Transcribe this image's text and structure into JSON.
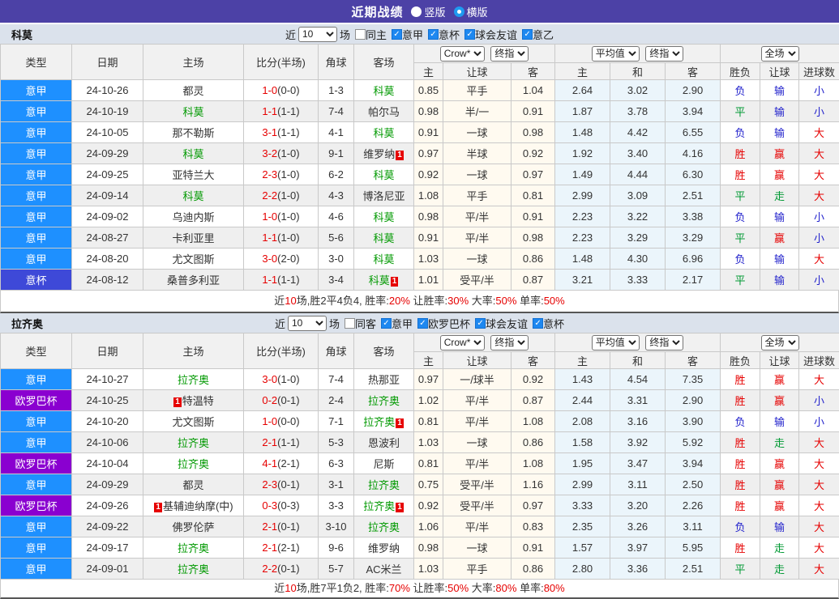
{
  "title_bar": {
    "title": "近期战绩",
    "options": [
      {
        "label": "竖版",
        "checked": false
      },
      {
        "label": "横版",
        "checked": true
      }
    ]
  },
  "red_card_label": "1",
  "league_colors": {
    "意甲": "#1e90ff",
    "意杯": "#3e49d8",
    "欧罗巴杯": "#8a00d0"
  },
  "result_colors": {
    "胜": "#e60000",
    "赢": "#e60000",
    "大": "#e60000",
    "平": "#009933",
    "走": "#009933",
    "负": "#2222cc",
    "输": "#2222cc",
    "小": "#2222cc"
  },
  "header_labels": {
    "left": [
      "类型",
      "日期",
      "主场",
      "比分(半场)",
      "角球",
      "客场"
    ],
    "odds_select1": "Crow*",
    "odds_select2": "终指",
    "odds_cols": [
      "主",
      "让球",
      "客"
    ],
    "avg_select1": "平均值",
    "avg_select2": "终指",
    "avg_cols": [
      "主",
      "和",
      "客"
    ],
    "full_select": "全场",
    "full_cols": [
      "胜负",
      "让球",
      "进球数"
    ]
  },
  "sections": [
    {
      "team": "科莫",
      "filter": {
        "near": "近",
        "count": "10",
        "games": "场",
        "same": {
          "label": "同主",
          "checked": false
        },
        "leagues": [
          {
            "label": "意甲",
            "checked": true
          },
          {
            "label": "意杯",
            "checked": true
          },
          {
            "label": "球会友谊",
            "checked": true
          },
          {
            "label": "意乙",
            "checked": true
          }
        ]
      },
      "rows": [
        {
          "league": "意甲",
          "date": "24-10-26",
          "home": {
            "name": "都灵",
            "focus": false,
            "rc": ""
          },
          "score": "1-0",
          "half": "(0-0)",
          "corner": "1-3",
          "away": {
            "name": "科莫",
            "focus": true,
            "rc": ""
          },
          "odds": [
            "0.85",
            "平手",
            "1.04"
          ],
          "avg": [
            "2.64",
            "3.02",
            "2.90"
          ],
          "result": [
            "负",
            "输",
            "小"
          ]
        },
        {
          "league": "意甲",
          "date": "24-10-19",
          "home": {
            "name": "科莫",
            "focus": true,
            "rc": ""
          },
          "score": "1-1",
          "half": "(1-1)",
          "corner": "7-4",
          "away": {
            "name": "帕尔马",
            "focus": false,
            "rc": ""
          },
          "odds": [
            "0.98",
            "半/一",
            "0.91"
          ],
          "avg": [
            "1.87",
            "3.78",
            "3.94"
          ],
          "result": [
            "平",
            "输",
            "小"
          ]
        },
        {
          "league": "意甲",
          "date": "24-10-05",
          "home": {
            "name": "那不勒斯",
            "focus": false,
            "rc": ""
          },
          "score": "3-1",
          "half": "(1-1)",
          "corner": "4-1",
          "away": {
            "name": "科莫",
            "focus": true,
            "rc": ""
          },
          "odds": [
            "0.91",
            "一球",
            "0.98"
          ],
          "avg": [
            "1.48",
            "4.42",
            "6.55"
          ],
          "result": [
            "负",
            "输",
            "大"
          ]
        },
        {
          "league": "意甲",
          "date": "24-09-29",
          "home": {
            "name": "科莫",
            "focus": true,
            "rc": ""
          },
          "score": "3-2",
          "half": "(1-0)",
          "corner": "9-1",
          "away": {
            "name": "维罗纳",
            "focus": false,
            "rc": "after"
          },
          "odds": [
            "0.97",
            "半球",
            "0.92"
          ],
          "avg": [
            "1.92",
            "3.40",
            "4.16"
          ],
          "result": [
            "胜",
            "赢",
            "大"
          ]
        },
        {
          "league": "意甲",
          "date": "24-09-25",
          "home": {
            "name": "亚特兰大",
            "focus": false,
            "rc": ""
          },
          "score": "2-3",
          "half": "(1-0)",
          "corner": "6-2",
          "away": {
            "name": "科莫",
            "focus": true,
            "rc": ""
          },
          "odds": [
            "0.92",
            "一球",
            "0.97"
          ],
          "avg": [
            "1.49",
            "4.44",
            "6.30"
          ],
          "result": [
            "胜",
            "赢",
            "大"
          ]
        },
        {
          "league": "意甲",
          "date": "24-09-14",
          "home": {
            "name": "科莫",
            "focus": true,
            "rc": ""
          },
          "score": "2-2",
          "half": "(1-0)",
          "corner": "4-3",
          "away": {
            "name": "博洛尼亚",
            "focus": false,
            "rc": ""
          },
          "odds": [
            "1.08",
            "平手",
            "0.81"
          ],
          "avg": [
            "2.99",
            "3.09",
            "2.51"
          ],
          "result": [
            "平",
            "走",
            "大"
          ]
        },
        {
          "league": "意甲",
          "date": "24-09-02",
          "home": {
            "name": "乌迪内斯",
            "focus": false,
            "rc": ""
          },
          "score": "1-0",
          "half": "(1-0)",
          "corner": "4-6",
          "away": {
            "name": "科莫",
            "focus": true,
            "rc": ""
          },
          "odds": [
            "0.98",
            "平/半",
            "0.91"
          ],
          "avg": [
            "2.23",
            "3.22",
            "3.38"
          ],
          "result": [
            "负",
            "输",
            "小"
          ]
        },
        {
          "league": "意甲",
          "date": "24-08-27",
          "home": {
            "name": "卡利亚里",
            "focus": false,
            "rc": ""
          },
          "score": "1-1",
          "half": "(1-0)",
          "corner": "5-6",
          "away": {
            "name": "科莫",
            "focus": true,
            "rc": ""
          },
          "odds": [
            "0.91",
            "平/半",
            "0.98"
          ],
          "avg": [
            "2.23",
            "3.29",
            "3.29"
          ],
          "result": [
            "平",
            "赢",
            "小"
          ]
        },
        {
          "league": "意甲",
          "date": "24-08-20",
          "home": {
            "name": "尤文图斯",
            "focus": false,
            "rc": ""
          },
          "score": "3-0",
          "half": "(2-0)",
          "corner": "3-0",
          "away": {
            "name": "科莫",
            "focus": true,
            "rc": ""
          },
          "odds": [
            "1.03",
            "一球",
            "0.86"
          ],
          "avg": [
            "1.48",
            "4.30",
            "6.96"
          ],
          "result": [
            "负",
            "输",
            "大"
          ]
        },
        {
          "league": "意杯",
          "date": "24-08-12",
          "home": {
            "name": "桑普多利亚",
            "focus": false,
            "rc": ""
          },
          "score": "1-1",
          "half": "(1-1)",
          "corner": "3-4",
          "away": {
            "name": "科莫",
            "focus": true,
            "rc": "after"
          },
          "odds": [
            "1.01",
            "受平/半",
            "0.87"
          ],
          "avg": [
            "3.21",
            "3.33",
            "2.17"
          ],
          "result": [
            "平",
            "输",
            "小"
          ]
        }
      ],
      "summary": [
        {
          "t": "近",
          "r": false
        },
        {
          "t": "10",
          "r": true
        },
        {
          "t": "场,胜2平4负4, 胜率:",
          "r": false
        },
        {
          "t": "20%",
          "r": true
        },
        {
          "t": " 让胜率:",
          "r": false
        },
        {
          "t": "30%",
          "r": true
        },
        {
          "t": " 大率:",
          "r": false
        },
        {
          "t": "50%",
          "r": true
        },
        {
          "t": " 单率:",
          "r": false
        },
        {
          "t": "50%",
          "r": true
        }
      ]
    },
    {
      "team": "拉齐奥",
      "filter": {
        "near": "近",
        "count": "10",
        "games": "场",
        "same": {
          "label": "同客",
          "checked": false
        },
        "leagues": [
          {
            "label": "意甲",
            "checked": true
          },
          {
            "label": "欧罗巴杯",
            "checked": true
          },
          {
            "label": "球会友谊",
            "checked": true
          },
          {
            "label": "意杯",
            "checked": true
          }
        ]
      },
      "rows": [
        {
          "league": "意甲",
          "date": "24-10-27",
          "home": {
            "name": "拉齐奥",
            "focus": true,
            "rc": ""
          },
          "score": "3-0",
          "half": "(1-0)",
          "corner": "7-4",
          "away": {
            "name": "热那亚",
            "focus": false,
            "rc": ""
          },
          "odds": [
            "0.97",
            "一/球半",
            "0.92"
          ],
          "avg": [
            "1.43",
            "4.54",
            "7.35"
          ],
          "result": [
            "胜",
            "赢",
            "大"
          ]
        },
        {
          "league": "欧罗巴杯",
          "date": "24-10-25",
          "home": {
            "name": "特温特",
            "focus": false,
            "rc": "before"
          },
          "score": "0-2",
          "half": "(0-1)",
          "corner": "2-4",
          "away": {
            "name": "拉齐奥",
            "focus": true,
            "rc": ""
          },
          "odds": [
            "1.02",
            "平/半",
            "0.87"
          ],
          "avg": [
            "2.44",
            "3.31",
            "2.90"
          ],
          "result": [
            "胜",
            "赢",
            "小"
          ]
        },
        {
          "league": "意甲",
          "date": "24-10-20",
          "home": {
            "name": "尤文图斯",
            "focus": false,
            "rc": ""
          },
          "score": "1-0",
          "half": "(0-0)",
          "corner": "7-1",
          "away": {
            "name": "拉齐奥",
            "focus": true,
            "rc": "after"
          },
          "odds": [
            "0.81",
            "平/半",
            "1.08"
          ],
          "avg": [
            "2.08",
            "3.16",
            "3.90"
          ],
          "result": [
            "负",
            "输",
            "小"
          ]
        },
        {
          "league": "意甲",
          "date": "24-10-06",
          "home": {
            "name": "拉齐奥",
            "focus": true,
            "rc": ""
          },
          "score": "2-1",
          "half": "(1-1)",
          "corner": "5-3",
          "away": {
            "name": "恩波利",
            "focus": false,
            "rc": ""
          },
          "odds": [
            "1.03",
            "一球",
            "0.86"
          ],
          "avg": [
            "1.58",
            "3.92",
            "5.92"
          ],
          "result": [
            "胜",
            "走",
            "大"
          ]
        },
        {
          "league": "欧罗巴杯",
          "date": "24-10-04",
          "home": {
            "name": "拉齐奥",
            "focus": true,
            "rc": ""
          },
          "score": "4-1",
          "half": "(2-1)",
          "corner": "6-3",
          "away": {
            "name": "尼斯",
            "focus": false,
            "rc": ""
          },
          "odds": [
            "0.81",
            "平/半",
            "1.08"
          ],
          "avg": [
            "1.95",
            "3.47",
            "3.94"
          ],
          "result": [
            "胜",
            "赢",
            "大"
          ]
        },
        {
          "league": "意甲",
          "date": "24-09-29",
          "home": {
            "name": "都灵",
            "focus": false,
            "rc": ""
          },
          "score": "2-3",
          "half": "(0-1)",
          "corner": "3-1",
          "away": {
            "name": "拉齐奥",
            "focus": true,
            "rc": ""
          },
          "odds": [
            "0.75",
            "受平/半",
            "1.16"
          ],
          "avg": [
            "2.99",
            "3.11",
            "2.50"
          ],
          "result": [
            "胜",
            "赢",
            "大"
          ]
        },
        {
          "league": "欧罗巴杯",
          "date": "24-09-26",
          "home": {
            "name": "基辅迪纳摩(中)",
            "focus": false,
            "rc": "before"
          },
          "score": "0-3",
          "half": "(0-3)",
          "corner": "3-3",
          "away": {
            "name": "拉齐奥",
            "focus": true,
            "rc": "after"
          },
          "odds": [
            "0.92",
            "受平/半",
            "0.97"
          ],
          "avg": [
            "3.33",
            "3.20",
            "2.26"
          ],
          "result": [
            "胜",
            "赢",
            "大"
          ]
        },
        {
          "league": "意甲",
          "date": "24-09-22",
          "home": {
            "name": "佛罗伦萨",
            "focus": false,
            "rc": ""
          },
          "score": "2-1",
          "half": "(0-1)",
          "corner": "3-10",
          "away": {
            "name": "拉齐奥",
            "focus": true,
            "rc": ""
          },
          "odds": [
            "1.06",
            "平/半",
            "0.83"
          ],
          "avg": [
            "2.35",
            "3.26",
            "3.11"
          ],
          "result": [
            "负",
            "输",
            "大"
          ]
        },
        {
          "league": "意甲",
          "date": "24-09-17",
          "home": {
            "name": "拉齐奥",
            "focus": true,
            "rc": ""
          },
          "score": "2-1",
          "half": "(2-1)",
          "corner": "9-6",
          "away": {
            "name": "维罗纳",
            "focus": false,
            "rc": ""
          },
          "odds": [
            "0.98",
            "一球",
            "0.91"
          ],
          "avg": [
            "1.57",
            "3.97",
            "5.95"
          ],
          "result": [
            "胜",
            "走",
            "大"
          ]
        },
        {
          "league": "意甲",
          "date": "24-09-01",
          "home": {
            "name": "拉齐奥",
            "focus": true,
            "rc": ""
          },
          "score": "2-2",
          "half": "(0-1)",
          "corner": "5-7",
          "away": {
            "name": "AC米兰",
            "focus": false,
            "rc": ""
          },
          "odds": [
            "1.03",
            "平手",
            "0.86"
          ],
          "avg": [
            "2.80",
            "3.36",
            "2.51"
          ],
          "result": [
            "平",
            "走",
            "大"
          ]
        }
      ],
      "summary": [
        {
          "t": "近",
          "r": false
        },
        {
          "t": "10",
          "r": true
        },
        {
          "t": "场,胜7平1负2, 胜率:",
          "r": false
        },
        {
          "t": "70%",
          "r": true
        },
        {
          "t": " 让胜率:",
          "r": false
        },
        {
          "t": "50%",
          "r": true
        },
        {
          "t": " 大率:",
          "r": false
        },
        {
          "t": "80%",
          "r": true
        },
        {
          "t": " 单率:",
          "r": false
        },
        {
          "t": "80%",
          "r": true
        }
      ]
    }
  ]
}
